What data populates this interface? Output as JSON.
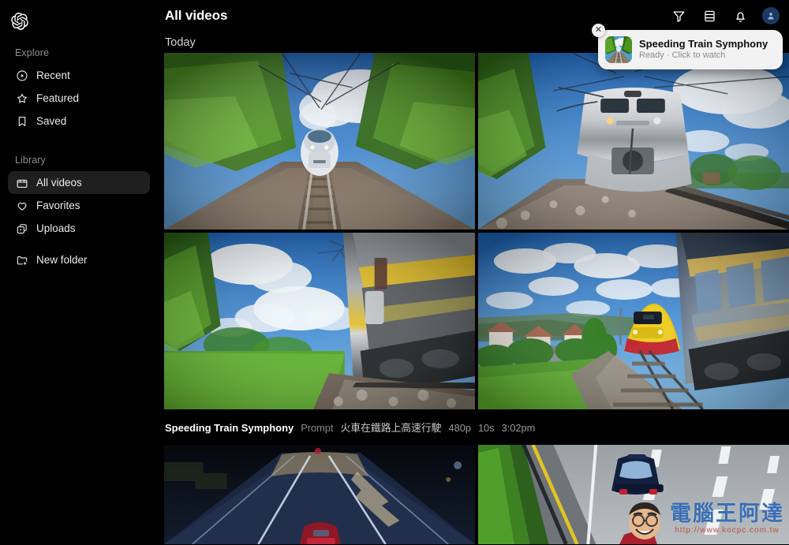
{
  "app": {
    "brand_icon": "openai-logo-icon",
    "background": "#000000"
  },
  "sidebar": {
    "sections": [
      {
        "title": "Explore",
        "items": [
          {
            "label": "Recent",
            "icon": "play-circle-icon",
            "active": false
          },
          {
            "label": "Featured",
            "icon": "star-icon",
            "active": false
          },
          {
            "label": "Saved",
            "icon": "bookmark-icon",
            "active": false
          }
        ]
      },
      {
        "title": "Library",
        "items": [
          {
            "label": "All videos",
            "icon": "film-box-icon",
            "active": true
          },
          {
            "label": "Favorites",
            "icon": "heart-icon",
            "active": false
          },
          {
            "label": "Uploads",
            "icon": "stacked-play-icon",
            "active": false
          },
          {
            "label": "New folder",
            "icon": "folder-plus-icon",
            "active": false
          }
        ]
      }
    ]
  },
  "header": {
    "title": "All videos",
    "actions": [
      {
        "name": "filter-icon",
        "label": "Filter"
      },
      {
        "name": "list-view-icon",
        "label": "List view"
      },
      {
        "name": "notifications-icon",
        "label": "Notifications"
      }
    ],
    "avatar": {
      "name": "user-avatar",
      "color": "#1b3a63"
    }
  },
  "main": {
    "section_label": "Today",
    "video_group": {
      "title": "Speeding Train Symphony",
      "prompt_key": "Prompt",
      "prompt_value": "火車在鐵路上高速行駛",
      "resolution": "480p",
      "duration": "10s",
      "time": "3:02pm",
      "tiles": [
        {
          "name": "video-tile-bullet-train-tracks",
          "alt": "Bullet train approaching along rail tracks"
        },
        {
          "name": "video-tile-silver-train-front",
          "alt": "Silver electric train head-on under blue sky"
        },
        {
          "name": "video-tile-yellow-stripe-train",
          "alt": "Train with yellow stripe passing at speed"
        },
        {
          "name": "video-tile-red-yellow-train",
          "alt": "Yellow and red regional train near village"
        }
      ]
    },
    "next_group": {
      "tiles": [
        {
          "name": "video-tile-night-highway",
          "alt": "Dark night highway lanes"
        },
        {
          "name": "video-tile-blue-car-road",
          "alt": "Blue car driving on multi-lane highway"
        }
      ]
    }
  },
  "toast": {
    "title": "Speeding Train Symphony",
    "subtitle": "Ready · Click to watch",
    "close_label": "✕",
    "thumb_name": "toast-video-thumbnail"
  },
  "watermark": {
    "text": "電腦王阿達",
    "url": "http://www.kocpc.com.tw"
  }
}
